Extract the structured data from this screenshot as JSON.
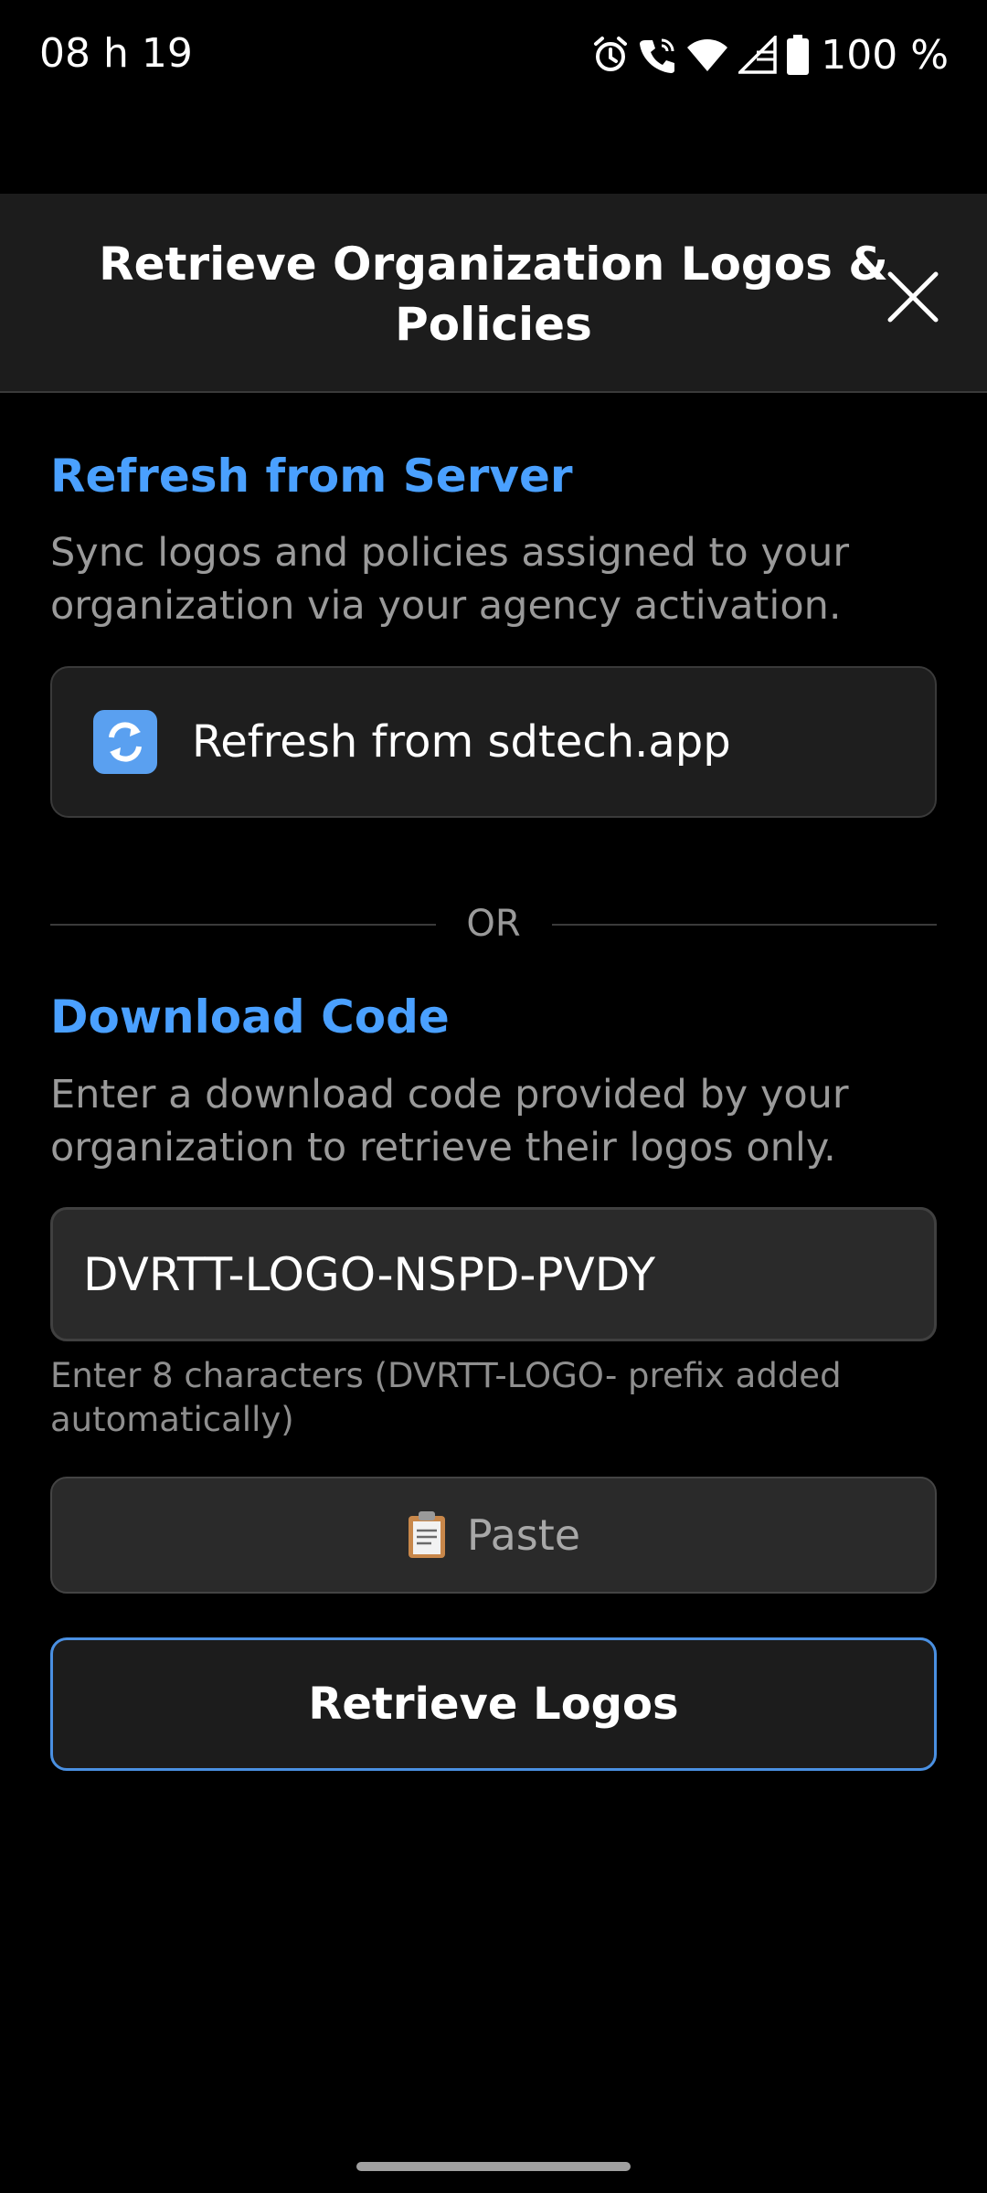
{
  "status_bar": {
    "time": "08 h 19",
    "battery": "100 %",
    "icons": [
      "alarm-icon",
      "wifi-calling-icon",
      "wifi-icon",
      "signal-icon",
      "battery-icon"
    ]
  },
  "header": {
    "title": "Retrieve Organization Logos & Policies",
    "close_icon": "close-icon"
  },
  "refresh_section": {
    "title": "Refresh from Server",
    "description": "Sync logos and policies assigned to your organization via your agency activation.",
    "button_label": "Refresh from sdtech.app",
    "button_icon": "refresh-icon"
  },
  "divider": {
    "label": "OR"
  },
  "download_section": {
    "title": "Download Code",
    "description": "Enter a download code provided by your organization to retrieve their logos only.",
    "input_value": "DVRTT-LOGO-NSPD-PVDY",
    "helper_text": "Enter 8 characters (DVRTT-LOGO- prefix added automatically)",
    "paste_label": "Paste",
    "paste_icon": "clipboard-icon",
    "retrieve_label": "Retrieve Logos"
  },
  "colors": {
    "accent": "#4aa0ff",
    "background": "#000000",
    "surface": "#1c1c1c",
    "button_border_accent": "#4a90e2"
  }
}
